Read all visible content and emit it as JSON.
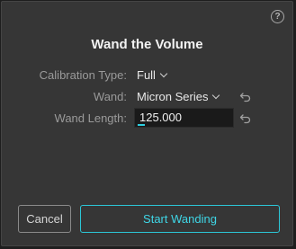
{
  "dialog": {
    "title": "Wand the Volume",
    "help_icon": "question-circle-icon",
    "help_glyph": "?"
  },
  "fields": {
    "calibration_type": {
      "label": "Calibration Type:",
      "value": "Full"
    },
    "wand": {
      "label": "Wand:",
      "value": "Micron Series"
    },
    "wand_length": {
      "label": "Wand Length:",
      "value": "125.000"
    }
  },
  "buttons": {
    "cancel_label": "Cancel",
    "start_label": "Start Wanding"
  },
  "colors": {
    "accent": "#2cc6d6",
    "panel_background": "#363636",
    "window_background": "#1e1e1e"
  }
}
